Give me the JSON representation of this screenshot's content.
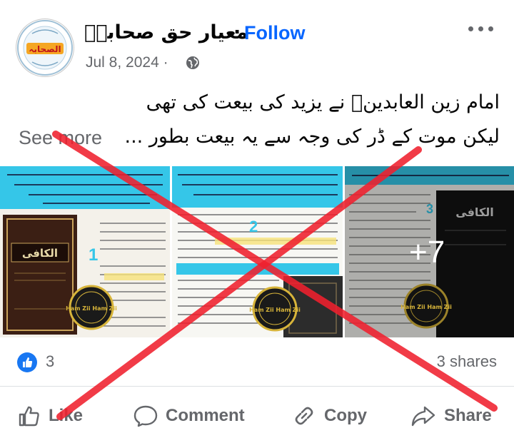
{
  "post": {
    "page_name": "معیار حق صحابہؓ",
    "separator": "·",
    "follow_label": "Follow",
    "date": "Jul 8, 2024 ·",
    "privacy_icon": "globe-icon",
    "text_line1": "امام زین العابدینؒ نے یزید کی بیعت کی تھی",
    "text_line2": "لیکن موت کے ڈر کی وجہ سے یہ بیعت بطور ...",
    "see_more": "See more",
    "avatar_text": "الصحابہ"
  },
  "photos": {
    "p1_title": "الکافی",
    "p1_num": "1",
    "p2_num": "2",
    "p3_num": "3",
    "p3_title": "الکافی",
    "watermark": "Ham Zii Ham Zii",
    "more_count": "+7"
  },
  "stats": {
    "reaction_icon": "like-icon",
    "reactions": "3",
    "shares": "3 shares"
  },
  "actions": {
    "like": "Like",
    "comment": "Comment",
    "copy": "Copy",
    "share": "Share"
  },
  "colors": {
    "follow": "#0866ff",
    "muted": "#65676b",
    "cross": "#f0202e",
    "cyan": "#35c6e8"
  }
}
